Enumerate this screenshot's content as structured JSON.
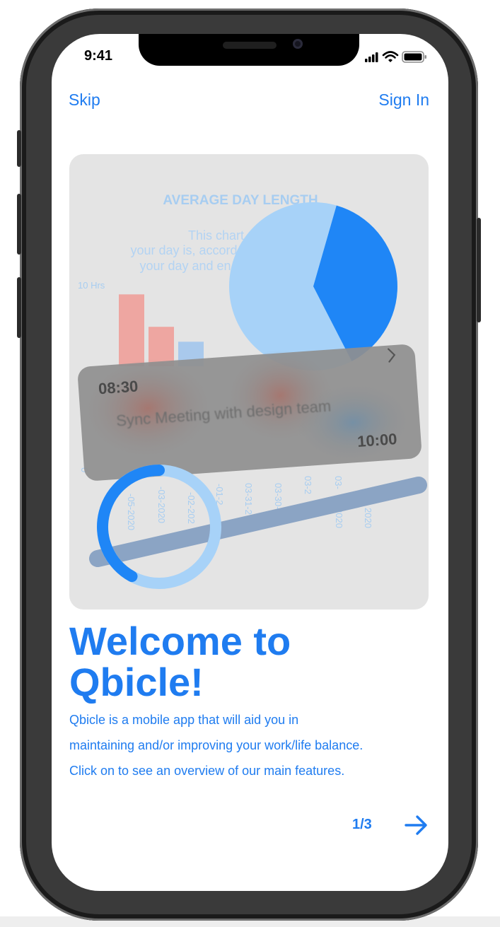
{
  "status_bar": {
    "time": "9:41"
  },
  "nav": {
    "skip_label": "Skip",
    "sign_in_label": "Sign In"
  },
  "hero": {
    "chart_title": "AVERAGE DAY LENGTH",
    "chart_desc_lines": [
      "This chart shows h",
      "your day is, accord",
      "your day and en"
    ],
    "y_axis_label": "10 Hrs",
    "bars": [
      0.82,
      0.45,
      0.28
    ],
    "date_labels": [
      "-05-2020",
      "-03-2020",
      "-02-202",
      "-01-2",
      "03-31-2",
      "03-30-",
      "03-2",
      "03-",
      "0"
    ],
    "date_labels_right": [
      "2020",
      "2020"
    ],
    "pie": {
      "dark_fraction": 0.38
    },
    "event_card": {
      "start_time": "08:30",
      "title": "Sync Meeting with design team",
      "end_time": "10:00"
    },
    "ring": {
      "progress": 0.42
    },
    "colors": {
      "dark_blue": "#1f86f6",
      "light_blue": "#a7d2f8",
      "bar_red": "#eea6a1"
    }
  },
  "welcome": {
    "title_line1": "Welcome to",
    "title_line2": "Qbicle!",
    "description_lines": [
      "Qbicle is a mobile app that will aid you in",
      "maintaining and/or improving your work/life balance.",
      "Click on to see an overview of our main features."
    ]
  },
  "pager": {
    "label": "1/3"
  },
  "theme": {
    "accent": "#1f7cf0"
  }
}
